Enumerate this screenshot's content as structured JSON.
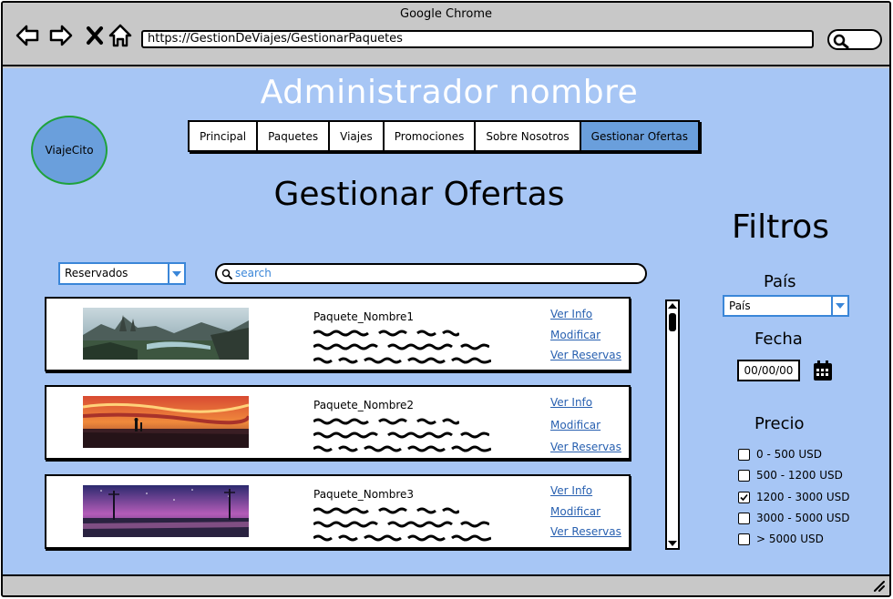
{
  "browser": {
    "title": "Google Chrome",
    "url": "https://GestionDeViajes/GestionarPaquetes"
  },
  "header": {
    "admin_title": "Administrador nombre",
    "logo_text": "ViajeCito"
  },
  "tabs": [
    {
      "label": "Principal",
      "active": false
    },
    {
      "label": "Paquetes",
      "active": false
    },
    {
      "label": "Viajes",
      "active": false
    },
    {
      "label": "Promociones",
      "active": false
    },
    {
      "label": "Sobre Nosotros",
      "active": false
    },
    {
      "label": "Gestionar Ofertas",
      "active": true
    }
  ],
  "main": {
    "title": "Gestionar Ofertas",
    "filter_dropdown": {
      "selected": "Reservados"
    },
    "search": {
      "placeholder": "search"
    },
    "packages": [
      {
        "name": "Paquete_Nombre1",
        "links": [
          "Ver Info",
          "Modificar",
          "Ver Reservas"
        ]
      },
      {
        "name": "Paquete_Nombre2",
        "links": [
          "Ver Info",
          "Modificar",
          "Ver Reservas"
        ]
      },
      {
        "name": "Paquete_Nombre3",
        "links": [
          "Ver Info",
          "Modificar",
          "Ver Reservas"
        ]
      }
    ]
  },
  "filters": {
    "title": "Filtros",
    "country_label": "País",
    "country_dropdown": {
      "selected": "País"
    },
    "date_label": "Fecha",
    "date_value": "00/00/00",
    "price_label": "Precio",
    "price_options": [
      {
        "label": "0 - 500 USD",
        "checked": false
      },
      {
        "label": "500 - 1200 USD",
        "checked": false
      },
      {
        "label": "1200 - 3000 USD",
        "checked": true
      },
      {
        "label": "3000 - 5000 USD",
        "checked": false
      },
      {
        "label": "> 5000 USD",
        "checked": false
      }
    ]
  },
  "colors": {
    "page_bg": "#a7c6f5",
    "active_tab": "#6a9fdc",
    "link": "#2860b0",
    "accent": "#3a86d8"
  }
}
